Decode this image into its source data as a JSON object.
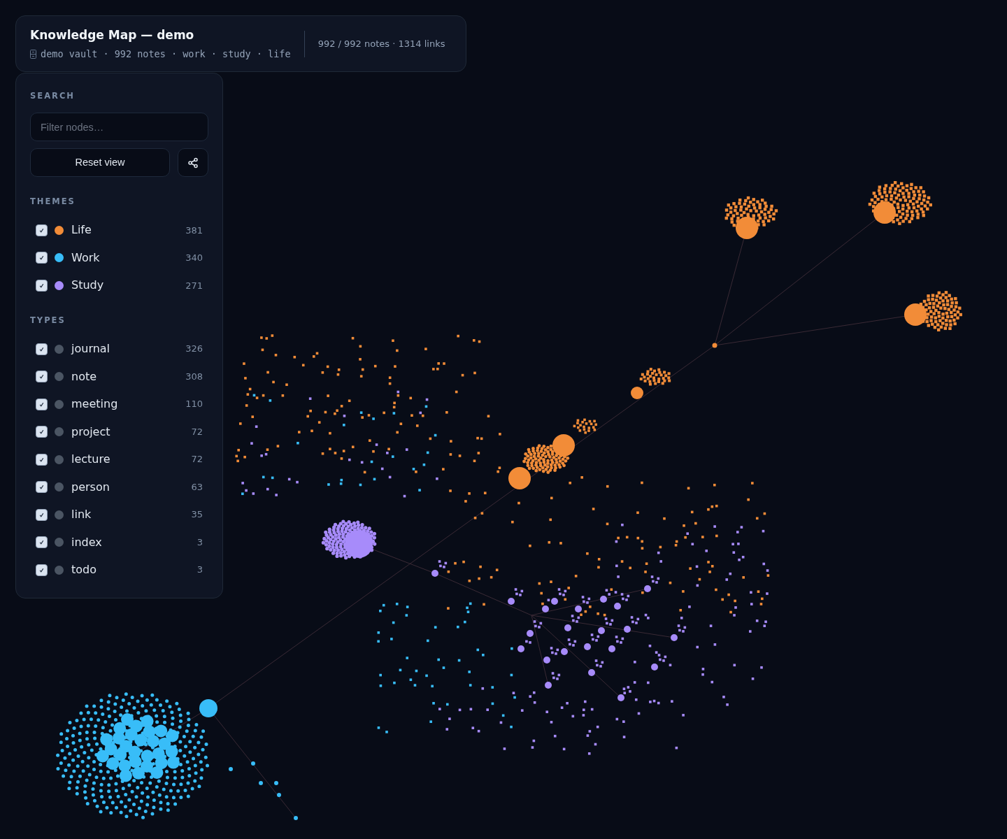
{
  "header": {
    "title": "Knowledge Map — demo",
    "subtitle": "demo vault · 992 notes · work · study · life",
    "stats": "992 / 992 notes · 1314 links"
  },
  "search": {
    "heading": "SEARCH",
    "placeholder": "Filter nodes…",
    "reset": "Reset view"
  },
  "themes": {
    "heading": "THEMES",
    "items": [
      {
        "label": "Life",
        "count": "381",
        "checked": true,
        "color": "#f28c38"
      },
      {
        "label": "Work",
        "count": "340",
        "checked": true,
        "color": "#38bdf8"
      },
      {
        "label": "Study",
        "count": "271",
        "checked": true,
        "color": "#a78bfa"
      }
    ]
  },
  "types": {
    "heading": "TYPES",
    "items": [
      {
        "label": "journal",
        "count": "326",
        "checked": true
      },
      {
        "label": "note",
        "count": "308",
        "checked": true
      },
      {
        "label": "meeting",
        "count": "110",
        "checked": true
      },
      {
        "label": "project",
        "count": "72",
        "checked": true
      },
      {
        "label": "lecture",
        "count": "72",
        "checked": true
      },
      {
        "label": "person",
        "count": "63",
        "checked": true
      },
      {
        "label": "link",
        "count": "35",
        "checked": true
      },
      {
        "label": "index",
        "count": "3",
        "checked": true
      },
      {
        "label": "todo",
        "count": "3",
        "checked": true
      }
    ]
  }
}
